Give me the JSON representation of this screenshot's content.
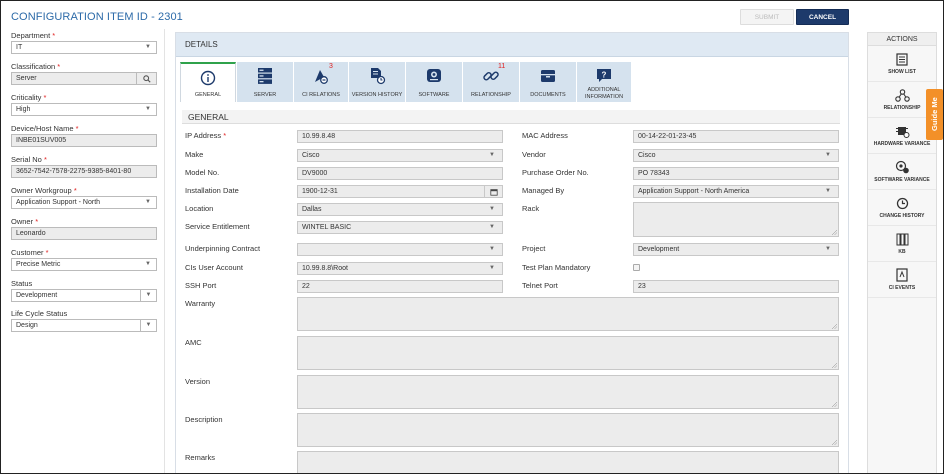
{
  "header": {
    "title": "CONFIGURATION ITEM ID - 2301",
    "submit_label": "SUBMIT",
    "cancel_label": "CANCEL"
  },
  "left_fields": [
    {
      "label": "Department",
      "required": "*",
      "value": "IT",
      "type": "select"
    },
    {
      "label": "Classification",
      "required": "*",
      "value": "Server",
      "type": "search"
    },
    {
      "label": "Criticality",
      "required": "*",
      "value": "High",
      "type": "select"
    },
    {
      "label": "Device/Host Name",
      "required": "*",
      "value": "INBE01SUV005",
      "type": "readonly"
    },
    {
      "label": "Serial No",
      "required": "*",
      "value": "3652-7542-7578-2275-9385-8401-80",
      "type": "readonly"
    },
    {
      "label": "Owner Workgroup",
      "required": "*",
      "value": "Application Support - North",
      "type": "select"
    },
    {
      "label": "Owner",
      "required": "*",
      "value": "Leonardo",
      "type": "readonly"
    },
    {
      "label": "Customer",
      "required": "*",
      "value": "Precise Metric",
      "type": "select"
    },
    {
      "label": "Status",
      "required": "",
      "value": "Development",
      "type": "select2"
    },
    {
      "label": "Life Cycle Status",
      "required": "",
      "value": "Design",
      "type": "select2"
    }
  ],
  "details": {
    "header": "DETAILS",
    "section_title": "GENERAL",
    "tabs": [
      {
        "label": "GENERAL",
        "icon": "info-icon",
        "badge": ""
      },
      {
        "label": "SERVER",
        "icon": "server-icon",
        "badge": ""
      },
      {
        "label": "CI RELATIONS",
        "icon": "ci-relations-icon",
        "badge": "3"
      },
      {
        "label": "VERSION HISTORY",
        "icon": "version-history-icon",
        "badge": ""
      },
      {
        "label": "SOFTWARE",
        "icon": "software-icon",
        "badge": ""
      },
      {
        "label": "RELATIONSHIP",
        "icon": "link-icon",
        "badge": "11"
      },
      {
        "label": "DOCUMENTS",
        "icon": "documents-icon",
        "badge": ""
      },
      {
        "label": "ADDITIONAL INFORMATION",
        "icon": "question-icon",
        "badge": ""
      }
    ],
    "fields": {
      "ip_address": {
        "label": "IP Address",
        "required": "*",
        "value": "10.99.8.48"
      },
      "mac_address": {
        "label": "MAC Address",
        "value": "00-14-22-01-23-45"
      },
      "make": {
        "label": "Make",
        "value": "Cisco"
      },
      "vendor": {
        "label": "Vendor",
        "value": "Cisco"
      },
      "model_no": {
        "label": "Model No.",
        "value": "DV9000"
      },
      "purchase_order": {
        "label": "Purchase Order No.",
        "value": "PO 78343"
      },
      "installation_date": {
        "label": "Installation Date",
        "value": "1900-12-31"
      },
      "managed_by": {
        "label": "Managed By",
        "value": "Application Support - North America"
      },
      "location": {
        "label": "Location",
        "value": "Dallas"
      },
      "rack": {
        "label": "Rack",
        "value": ""
      },
      "service_entitlement": {
        "label": "Service Entitlement",
        "value": "WINTEL BASIC"
      },
      "underpinning_contract": {
        "label": "Underpinning Contract",
        "value": ""
      },
      "project": {
        "label": "Project",
        "value": "Development"
      },
      "cis_user_account": {
        "label": "CIs User Account",
        "value": "10.99.8.8\\Root"
      },
      "test_plan": {
        "label": "Test Plan Mandatory"
      },
      "ssh_port": {
        "label": "SSH Port",
        "value": "22"
      },
      "telnet_port": {
        "label": "Telnet Port",
        "value": "23"
      },
      "warranty": {
        "label": "Warranty"
      },
      "amc": {
        "label": "AMC"
      },
      "version": {
        "label": "Version"
      },
      "description": {
        "label": "Description"
      },
      "remarks": {
        "label": "Remarks"
      }
    }
  },
  "actions": {
    "header": "ACTIONS",
    "items": [
      {
        "label": "SHOW LIST",
        "icon": "list-icon"
      },
      {
        "label": "RELATIONSHIP",
        "icon": "relationship-icon"
      },
      {
        "label": "HARDWARE VARIANCE",
        "icon": "hardware-variance-icon"
      },
      {
        "label": "SOFTWARE VARIANCE",
        "icon": "software-variance-icon"
      },
      {
        "label": "CHANGE HISTORY",
        "icon": "change-history-icon"
      },
      {
        "label": "KB",
        "icon": "kb-icon"
      },
      {
        "label": "CI EVENTS",
        "icon": "ci-events-icon"
      }
    ],
    "guide_label": "Guide Me"
  },
  "colors": {
    "accent": "#2c6aa8",
    "cancel_bg": "#1d3a6b",
    "guide": "#f39028",
    "tab_bg": "#d5e2ee",
    "required": "#e02020"
  }
}
